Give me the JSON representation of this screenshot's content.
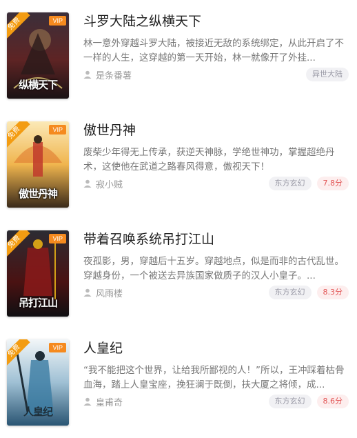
{
  "books": [
    {
      "title": "斗罗大陆之纵横天下",
      "description": "林一意外穿越斗罗大陆，被接近无敌的系统绑定，从此开启了不一样的人生，这穿越的第一天开始，林一就像开了外挂...",
      "author": "是条番薯",
      "category": "异世大陆",
      "score": "",
      "free_label": "免费",
      "vip_label": "VIP",
      "cover_text": "纵横天下",
      "cover_colors": [
        "#2a1f2b",
        "#6a2a2a",
        "#c9b26a"
      ]
    },
    {
      "title": "傲世丹神",
      "description": "废柴少年得无上传承，获逆天神脉，学绝世神功，掌握超绝丹术，这使他在武道之路春风得意，傲视天下！",
      "author": "寂小贼",
      "category": "东方玄幻",
      "score": "7.8分",
      "free_label": "免费",
      "vip_label": "VIP",
      "cover_text": "傲世丹神",
      "cover_colors": [
        "#f4d98a",
        "#e6a33d",
        "#c0392b"
      ]
    },
    {
      "title": "带着召唤系统吊打江山",
      "description": "夜孤影，男，穿越后十五岁。穿越地点，似是而非的古代乱世。穿越身份，一个被送去异族国家做质子的汉人小皇子。...",
      "author": "风雨楼",
      "category": "东方玄幻",
      "score": "8.3分",
      "free_label": "免费",
      "vip_label": "VIP",
      "cover_text": "吊打江山",
      "cover_colors": [
        "#1b1b1f",
        "#5a1414",
        "#d4a017"
      ]
    },
    {
      "title": "人皇纪",
      "description": "“我不能把这个世界，让给我所鄙视的人！”所以，王冲踩着枯骨血海，踏上人皇宝座，挽狂澜于既倒，扶大厦之将倾，成...",
      "author": "皇甫奇",
      "category": "东方玄幻",
      "score": "8.6分",
      "free_label": "免费",
      "vip_label": "VIP",
      "cover_text": "人皇纪",
      "cover_colors": [
        "#dfe9ef",
        "#7fa6bf",
        "#1f4a66"
      ]
    }
  ],
  "icons": {
    "author": "user-icon"
  }
}
